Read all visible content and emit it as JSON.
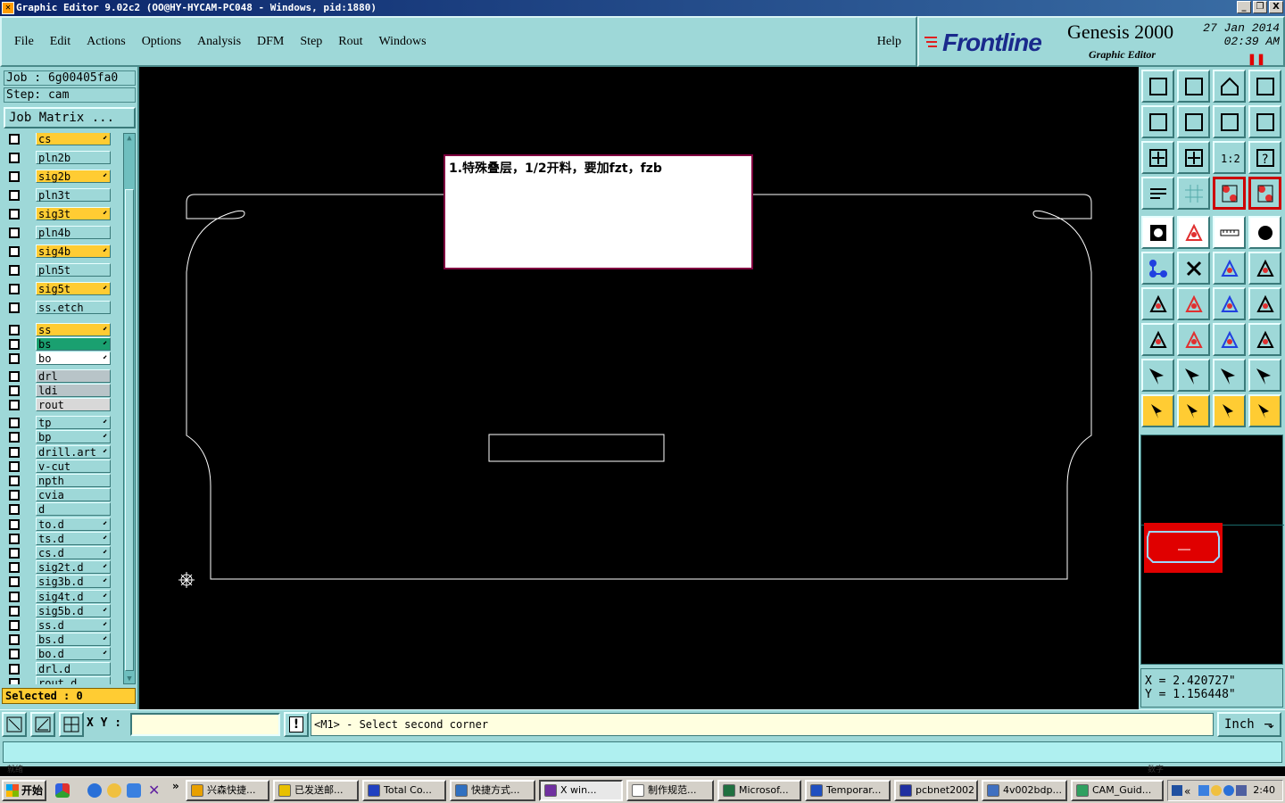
{
  "window": {
    "title": "Graphic Editor 9.02c2  (OO@HY-HYCAM-PC048 - Windows, pid:1880)",
    "controls": [
      "_",
      "❐",
      "X"
    ]
  },
  "menu": {
    "items": [
      "File",
      "Edit",
      "Actions",
      "Options",
      "Analysis",
      "DFM",
      "Step",
      "Rout",
      "Windows"
    ],
    "help": "Help"
  },
  "brand": {
    "logo": "Frontline",
    "product": "Genesis 2000",
    "subtitle": "Graphic Editor",
    "date": "27 Jan 2014",
    "time": "02:39  AM",
    "pause_icon": "pause-icon"
  },
  "job": {
    "job_label": "Job  :  6g00405fa0",
    "step_label": "Step:  cam",
    "matrix_button": "Job Matrix ...",
    "selected": "Selected : 0"
  },
  "layers": [
    {
      "name": "cs",
      "color": "#ffcc33",
      "flag": "⬋"
    },
    {
      "name": "pln2b",
      "color": "#9ed8d8",
      "flag": ""
    },
    {
      "name": "sig2b",
      "color": "#ffcc33",
      "flag": "⬋"
    },
    {
      "name": "pln3t",
      "color": "#9ed8d8",
      "flag": ""
    },
    {
      "name": "sig3t",
      "color": "#ffcc33",
      "flag": "⬋"
    },
    {
      "name": "pln4b",
      "color": "#9ed8d8",
      "flag": ""
    },
    {
      "name": "sig4b",
      "color": "#ffcc33",
      "flag": "⬋"
    },
    {
      "name": "pln5t",
      "color": "#9ed8d8",
      "flag": ""
    },
    {
      "name": "sig5t",
      "color": "#ffcc33",
      "flag": "⬋"
    },
    {
      "name": "ss.etch",
      "color": "#9ed8d8",
      "flag": ""
    },
    {
      "name": "ss",
      "color": "#ffcc33",
      "flag": "⬋"
    },
    {
      "name": "bs",
      "color": "#1aa070",
      "flag": "⬋"
    },
    {
      "name": "bo",
      "color": "#ffffff",
      "flag": "⬋"
    },
    {
      "name": "drl",
      "color": "#b8c4c8",
      "flag": ""
    },
    {
      "name": "ldi",
      "color": "#b8c4c8",
      "flag": ""
    },
    {
      "name": "rout",
      "color": "#d8d8d8",
      "flag": ""
    },
    {
      "name": "tp",
      "color": "#9ed8d8",
      "flag": "⬋"
    },
    {
      "name": "bp",
      "color": "#9ed8d8",
      "flag": "⬋"
    },
    {
      "name": "drill.art",
      "color": "#9ed8d8",
      "flag": "⬋"
    },
    {
      "name": "v-cut",
      "color": "#9ed8d8",
      "flag": ""
    },
    {
      "name": "npth",
      "color": "#9ed8d8",
      "flag": ""
    },
    {
      "name": "cvia",
      "color": "#9ed8d8",
      "flag": ""
    },
    {
      "name": "d",
      "color": "#9ed8d8",
      "flag": ""
    },
    {
      "name": "to.d",
      "color": "#9ed8d8",
      "flag": "⬋"
    },
    {
      "name": "ts.d",
      "color": "#9ed8d8",
      "flag": "⬋"
    },
    {
      "name": "cs.d",
      "color": "#9ed8d8",
      "flag": "⬋"
    },
    {
      "name": "sig2t.d",
      "color": "#9ed8d8",
      "flag": "⬋"
    },
    {
      "name": "sig3b.d",
      "color": "#9ed8d8",
      "flag": "⬋"
    },
    {
      "name": "sig4t.d",
      "color": "#9ed8d8",
      "flag": "⬋"
    },
    {
      "name": "sig5b.d",
      "color": "#9ed8d8",
      "flag": "⬋"
    },
    {
      "name": "ss.d",
      "color": "#9ed8d8",
      "flag": "⬋"
    },
    {
      "name": "bs.d",
      "color": "#9ed8d8",
      "flag": "⬋"
    },
    {
      "name": "bo.d",
      "color": "#9ed8d8",
      "flag": "⬋"
    },
    {
      "name": "drl.d",
      "color": "#9ed8d8",
      "flag": ""
    },
    {
      "name": "rout.d",
      "color": "#9ed8d8",
      "flag": ""
    }
  ],
  "canvas": {
    "note_text": "1.特殊叠层，1/2开料，要加fzt，fzb",
    "origin_icon": "origin-crosshair-icon"
  },
  "coords": {
    "x": "X  =  2.420727\"",
    "y": "Y  =  1.156448\""
  },
  "toolbar": [
    "home-view-icon",
    "zoom-down-icon",
    "house-icon",
    "split-view-icon",
    "pan-left-icon",
    "pan-right-icon",
    "undo-zoom-icon",
    "redraw-icon",
    "fit-all-icon",
    "center-icon",
    "scale-1-2-icon",
    "help-icon",
    "settings-icon",
    "grid-icon",
    "layers-toggle-icon",
    "layers-red-icon",
    "camera-icon",
    "shape-edit-icon",
    "ruler-icon",
    "circle-pad-icon",
    "nodes-icon",
    "cross-delete-icon",
    "points-connect-icon",
    "point-move-icon",
    "angle-icon",
    "line-pick-icon",
    "arc-icon",
    "flip-icon",
    "snap-point-icon",
    "minus-line-icon",
    "measure-icon",
    "copy-shapes-icon",
    "triangle-a-icon",
    "triangle-b-icon",
    "triangle-c-icon",
    "triangle-d-icon",
    "arrow-pointer-icon",
    "arrow-select-icon",
    "arrow-area-icon",
    "path-select-icon"
  ],
  "command": {
    "xy_label": "X Y :",
    "xy_value": "",
    "prompt": "<M1> - Select second corner",
    "units": "Inch",
    "status_left": "就绪",
    "status_right": "数字"
  },
  "taskbar": {
    "start": "开始",
    "items": [
      {
        "label": "兴森快捷...",
        "color": "#e8a000"
      },
      {
        "label": "已发送邮...",
        "color": "#e8c000"
      },
      {
        "label": "Total Co...",
        "color": "#2040c0"
      },
      {
        "label": "快捷方式...",
        "color": "#3070c0"
      },
      {
        "label": "X win...",
        "color": "#7030a0",
        "active": true
      },
      {
        "label": "制作规范...",
        "color": "#ffffff"
      },
      {
        "label": "Microsof...",
        "color": "#207040"
      },
      {
        "label": "Temporar...",
        "color": "#2050c0"
      },
      {
        "label": "pcbnet2002",
        "color": "#2030a0"
      },
      {
        "label": "4v002bdp...",
        "color": "#4070c0"
      },
      {
        "label": "CAM_Guid...",
        "color": "#30a060"
      }
    ],
    "clock": "2:40"
  }
}
